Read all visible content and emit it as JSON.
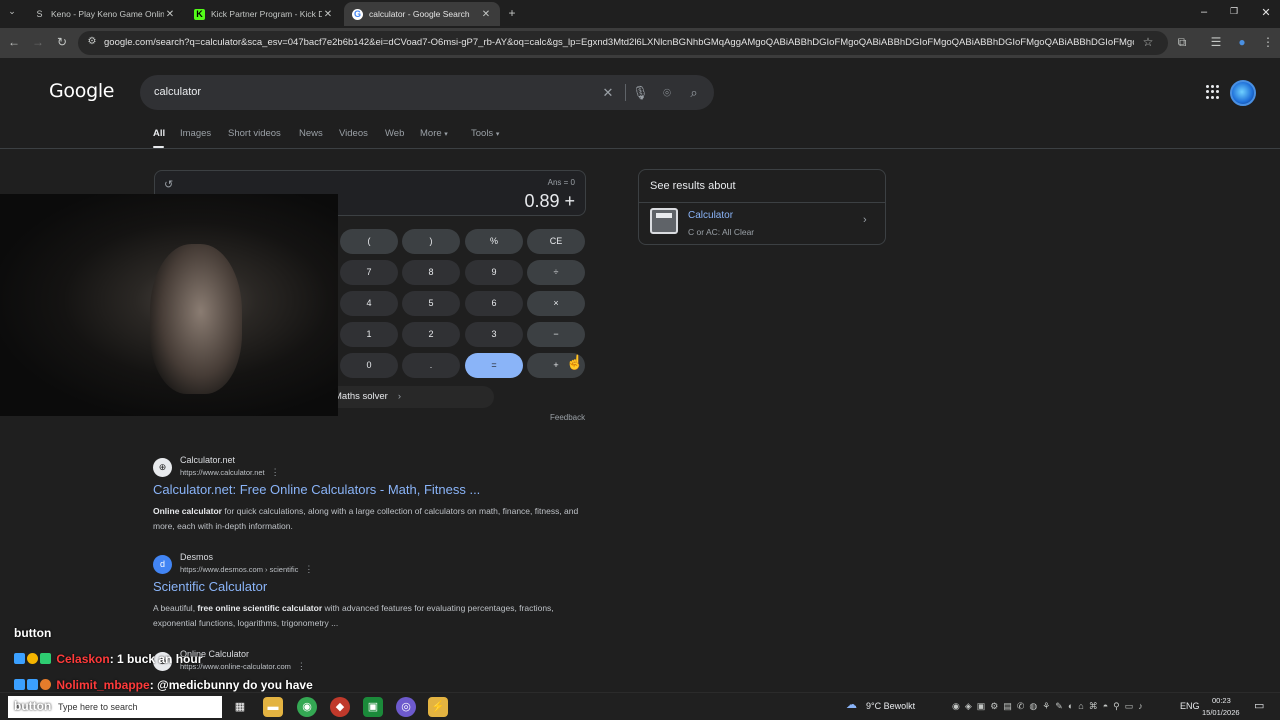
{
  "browser": {
    "tabs": [
      {
        "title": "Keno - Play Keno Game Online",
        "favicon": "S",
        "active": false
      },
      {
        "title": "Kick Partner Program - Kick Das",
        "favicon": "K",
        "active": false
      },
      {
        "title": "calculator - Google Search",
        "favicon": "G",
        "active": true
      }
    ],
    "url": "google.com/search?q=calculator&sca_esv=047bacf7e2b6b142&ei=dCVoad7-O6msi-gP7_rb-AY&oq=calc&gs_lp=Egxnd3Mtd2l6LXNlcnBGNhbGMqAggAMgoQABiABBhDGIoFMgoQABiABBhDGIoFMgoQABiABBhDGIoFMgoQABiABBhDGIoFMgoQA..."
  },
  "search": {
    "logo": "Google",
    "query": "calculator",
    "tabs": [
      "All",
      "Images",
      "Short videos",
      "News",
      "Videos",
      "Web",
      "More",
      "Tools"
    ]
  },
  "calculator": {
    "ans": "Ans = 0",
    "display": "0.89 +",
    "keys": [
      {
        "label": "(",
        "kind": "op"
      },
      {
        "label": ")",
        "kind": "op"
      },
      {
        "label": "%",
        "kind": "op"
      },
      {
        "label": "CE",
        "kind": "op"
      },
      {
        "label": "7",
        "kind": "num"
      },
      {
        "label": "8",
        "kind": "num"
      },
      {
        "label": "9",
        "kind": "num"
      },
      {
        "label": "÷",
        "kind": "op"
      },
      {
        "label": "4",
        "kind": "num"
      },
      {
        "label": "5",
        "kind": "num"
      },
      {
        "label": "6",
        "kind": "num"
      },
      {
        "label": "×",
        "kind": "op"
      },
      {
        "label": "1",
        "kind": "num"
      },
      {
        "label": "2",
        "kind": "num"
      },
      {
        "label": "3",
        "kind": "num"
      },
      {
        "label": "−",
        "kind": "op"
      },
      {
        "label": "0",
        "kind": "num"
      },
      {
        "label": ".",
        "kind": "num"
      },
      {
        "label": "=",
        "kind": "eq"
      },
      {
        "label": "+",
        "kind": "op"
      }
    ],
    "solver": "Maths solver",
    "feedback": "Feedback"
  },
  "side_panel": {
    "heading": "See results about",
    "title": "Calculator",
    "subtitle": "C or AC: All Clear"
  },
  "results": [
    {
      "site": "Calculator.net",
      "url": "https://www.calculator.net",
      "title": "Calculator.net: Free Online Calculators - Math, Fitness ...",
      "snippet_bold": "Online calculator",
      "snippet_rest": " for quick calculations, along with a large collection of calculators on math, finance, fitness, and more, each with in-depth information.",
      "snippet_pre": ""
    },
    {
      "site": "Desmos",
      "url": "https://www.desmos.com › scientific",
      "title": "Scientific Calculator",
      "snippet_pre": "A beautiful, ",
      "snippet_bold": "free online scientific calculator",
      "snippet_rest": " with advanced features for evaluating percentages, fractions, exponential functions, logarithms, trigonometry ..."
    },
    {
      "site": "Online Calculator",
      "url": "https://www.online-calculator.com"
    }
  ],
  "chat": {
    "line0": "button",
    "line1_user": "Celaskon",
    "line1_text": ": 1 buck an hour",
    "line2_user": "Nolimit_mbappe",
    "line2_text": ": @medicbunny do you have",
    "line3": "button"
  },
  "taskbar": {
    "search_placeholder": "Type here to search",
    "weather": "9°C  Bewolkt",
    "lang": "ENG",
    "time": "00:23",
    "date": "15/01/2026"
  }
}
